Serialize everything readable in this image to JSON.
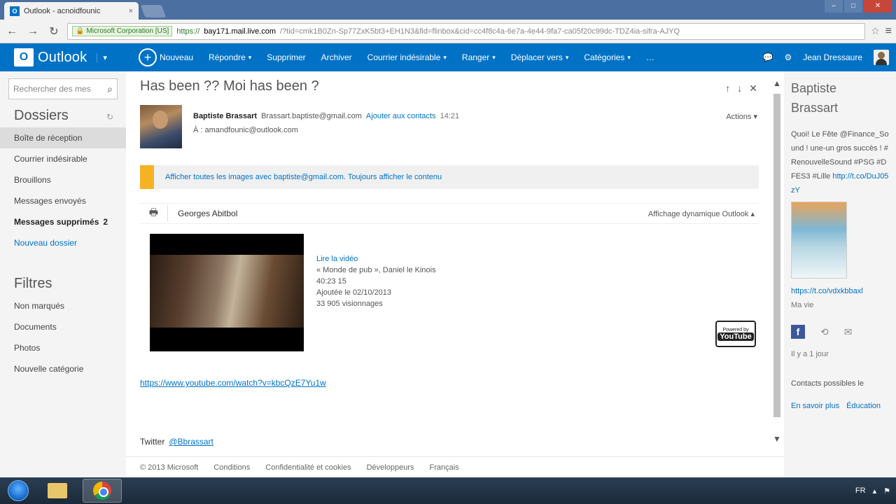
{
  "browser": {
    "tab_title": "Outlook - acnoidfounic",
    "tab_close": "×",
    "ev_label": "Microsoft Corporation [US]",
    "url_scheme": "https://",
    "url_host": "bay171.mail.live.com",
    "url_rest": "/?tid=cmk1B0Zn-Sp77ZxK5bt3+EH1N3&fid=flinbox&cid=cc4f8c4a-6e7a-4e44-9fa7-ca05f20c99dc-TDZ4ia-sifra-AJYQ"
  },
  "app": {
    "logo_letter": "O",
    "brand": "Outlook",
    "commands": [
      {
        "label": "Nouveau",
        "has_dd": false,
        "icon": "plus-circle-icon"
      },
      {
        "label": "Répondre",
        "has_dd": true
      },
      {
        "label": "Supprimer",
        "has_dd": false
      },
      {
        "label": "Archiver",
        "has_dd": false
      },
      {
        "label": "Courrier indésirable",
        "has_dd": true
      },
      {
        "label": "Ranger",
        "has_dd": true
      },
      {
        "label": "Déplacer vers",
        "has_dd": true
      },
      {
        "label": "Catégories",
        "has_dd": true
      },
      {
        "label": "…",
        "has_dd": false
      }
    ],
    "dropdown_glyph": "▾",
    "user_name": "Jean Dressaure"
  },
  "sidebar": {
    "search_placeholder": "Rechercher des mes",
    "folders_title": "Dossiers",
    "folders": [
      {
        "label": "Boîte de réception",
        "selected": true,
        "bold": false,
        "link": false,
        "count": ""
      },
      {
        "label": "Courrier indésirable",
        "selected": false,
        "bold": false,
        "link": false,
        "count": ""
      },
      {
        "label": "Brouillons",
        "selected": false,
        "bold": false,
        "link": false,
        "count": ""
      },
      {
        "label": "Messages envoyés",
        "selected": false,
        "bold": false,
        "link": false,
        "count": ""
      },
      {
        "label": "Messages supprimés",
        "selected": false,
        "bold": true,
        "link": false,
        "count": "2"
      },
      {
        "label": "Nouveau dossier",
        "selected": false,
        "bold": false,
        "link": true,
        "count": ""
      }
    ],
    "filters_title": "Filtres",
    "filters": [
      {
        "label": "Non marqués"
      },
      {
        "label": "Documents"
      },
      {
        "label": "Photos"
      },
      {
        "label": "Nouvelle catégorie"
      }
    ]
  },
  "message": {
    "subject": "Has been ?? Moi has been ?",
    "sender_name": "Baptiste Brassart",
    "sender_email": "Brassart.baptiste@gmail.com",
    "add_contact": "Ajouter aux contacts",
    "date": "14:21",
    "to": "À : amandfounic@outlook.com",
    "actions": "Actions",
    "info_message": "Afficher toutes les images avec baptiste@gmail.com. Toujours afficher le contenu",
    "from_context": "Georges Abitbol",
    "display_mode": "Affichage dynamique Outlook",
    "video_title": "Lire la vidéo",
    "video_lines": [
      "« Monde de pub », Daniel le Kinois",
      "40:23 15",
      "Ajoutée le 02/10/2013",
      "33 905 visionnages"
    ],
    "yt_powered": "Powered by",
    "yt_logo": "YouTube",
    "yt_link": "https://www.youtube.com/watch?v=kbcQzE7Yu1w",
    "tweet_label": "Twitter",
    "tweet_handle": "@Bbrassart"
  },
  "footer": {
    "items": [
      "© 2013 Microsoft",
      "Conditions",
      "Confidentialité et cookies",
      "Développeurs",
      "Français"
    ]
  },
  "people": {
    "name_line1": "Baptiste",
    "name_line2": "Brassart",
    "tweet_text": "Quoi! Le Fête @Finance_Sound ! une-un gros succès ! #RenouvelleSound #PSG #DFES3 #Lille",
    "tweet_link": "http://t.co/DuJ05zY",
    "link2": "https://t.co/vdxkbbaxl",
    "sub": "Ma vie",
    "fb_icon_letter": "f",
    "time": "Il y a 1 jour",
    "more": "Contacts possibles le",
    "bottom_left": "En savoir plus",
    "bottom_right": "Éducation"
  },
  "taskbar": {
    "tray_lang": "FR"
  }
}
